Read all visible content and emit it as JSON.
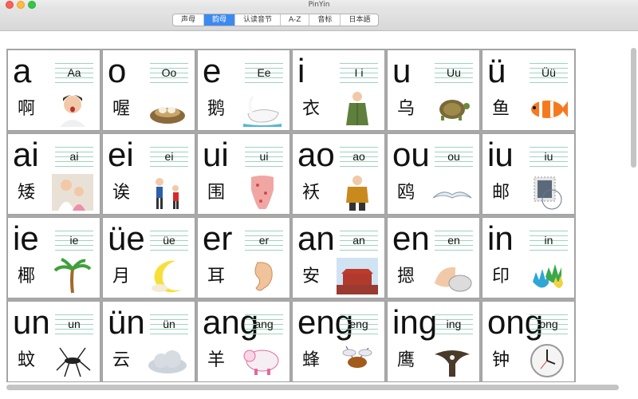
{
  "window": {
    "title": "PinYin"
  },
  "tabs": [
    "声母",
    "韵母",
    "认读音节",
    "A-Z",
    "音标",
    "日本語"
  ],
  "active_tab": "韵母",
  "cards": [
    {
      "big": "a",
      "small": "Aa",
      "han": "啊",
      "icon": "woman-singing-icon"
    },
    {
      "big": "o",
      "small": "Oo",
      "han": "喔",
      "icon": "nest-icon"
    },
    {
      "big": "e",
      "small": "Ee",
      "han": "鹅",
      "icon": "swan-icon"
    },
    {
      "big": "i",
      "small": "I i",
      "han": "衣",
      "icon": "coat-icon"
    },
    {
      "big": "u",
      "small": "Uu",
      "han": "乌",
      "icon": "turtle-icon"
    },
    {
      "big": "ü",
      "small": "Üü",
      "han": "鱼",
      "icon": "clownfish-icon"
    },
    {
      "big": "ai",
      "small": "ai",
      "han": "矮",
      "icon": "children-icon"
    },
    {
      "big": "ei",
      "small": "ei",
      "han": "诶",
      "icon": "kids-playing-icon"
    },
    {
      "big": "ui",
      "small": "ui",
      "han": "围",
      "icon": "scarf-icon"
    },
    {
      "big": "ao",
      "small": "ao",
      "han": "袄",
      "icon": "jacket-icon"
    },
    {
      "big": "ou",
      "small": "ou",
      "han": "鸥",
      "icon": "seagull-icon"
    },
    {
      "big": "iu",
      "small": "iu",
      "han": "邮",
      "icon": "stamp-icon"
    },
    {
      "big": "ie",
      "small": "ie",
      "han": "椰",
      "icon": "palm-tree-icon"
    },
    {
      "big": "üe",
      "small": "üe",
      "han": "月",
      "icon": "moon-icon"
    },
    {
      "big": "er",
      "small": "er",
      "han": "耳",
      "icon": "ear-icon"
    },
    {
      "big": "an",
      "small": "an",
      "han": "安",
      "icon": "tiananmen-icon"
    },
    {
      "big": "en",
      "small": "en",
      "han": "摁",
      "icon": "mouse-click-icon"
    },
    {
      "big": "in",
      "small": "in",
      "han": "印",
      "icon": "handprint-icon"
    },
    {
      "big": "un",
      "small": "un",
      "han": "蚊",
      "icon": "mosquito-icon"
    },
    {
      "big": "ün",
      "small": "ün",
      "han": "云",
      "icon": "cloud-icon"
    },
    {
      "big": "ang",
      "small": "ang",
      "han": "羊",
      "icon": "sheep-icon"
    },
    {
      "big": "eng",
      "small": "eng",
      "han": "蜂",
      "icon": "bee-icon"
    },
    {
      "big": "ing",
      "small": "ing",
      "han": "鹰",
      "icon": "eagle-icon"
    },
    {
      "big": "ong",
      "small": "ong",
      "han": "钟",
      "icon": "clock-icon"
    }
  ]
}
